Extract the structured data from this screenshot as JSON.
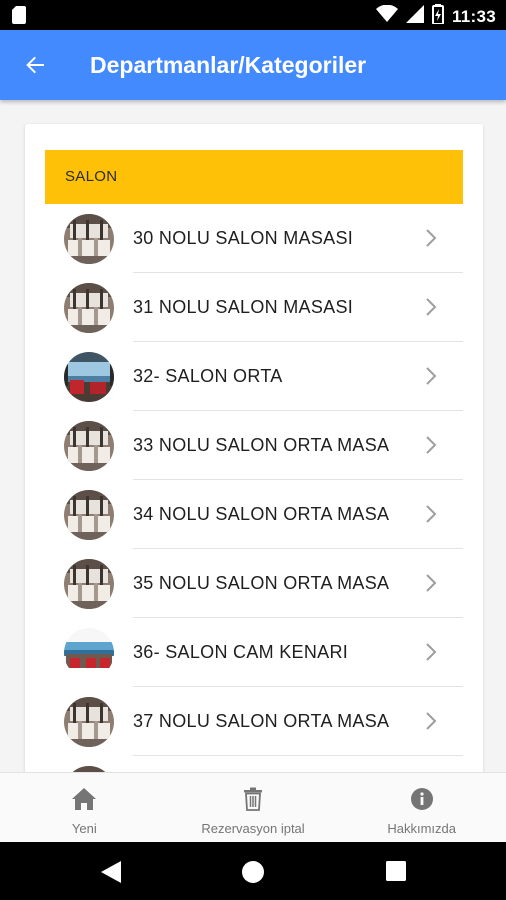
{
  "status_bar": {
    "time": "11:33"
  },
  "app_bar": {
    "title": "Departmanlar/Kategoriler",
    "back_icon": "arrow-back-icon"
  },
  "section": {
    "title": "SALON"
  },
  "items": [
    {
      "label": "30 NOLU SALON MASASI",
      "thumb": "restaurant-tables"
    },
    {
      "label": "31 NOLU SALON MASASI",
      "thumb": "restaurant-tables"
    },
    {
      "label": "32- SALON ORTA",
      "thumb": "restaurant-window"
    },
    {
      "label": "33 NOLU SALON ORTA MASA",
      "thumb": "restaurant-tables"
    },
    {
      "label": "34 NOLU SALON ORTA MASA",
      "thumb": "restaurant-tables"
    },
    {
      "label": "35 NOLU SALON ORTA MASA",
      "thumb": "restaurant-tables"
    },
    {
      "label": "36- SALON CAM KENARI",
      "thumb": "restaurant-seaview"
    },
    {
      "label": "37 NOLU SALON ORTA MASA",
      "thumb": "restaurant-tables"
    },
    {
      "label": "",
      "thumb": "restaurant-tables"
    }
  ],
  "bottom_nav": [
    {
      "label": "Yeni",
      "icon": "home-icon"
    },
    {
      "label": "Rezervasyon iptal",
      "icon": "trash-icon"
    },
    {
      "label": "Hakkımızda",
      "icon": "info-icon"
    }
  ],
  "colors": {
    "primary": "#448aff",
    "section": "#ffc107"
  }
}
